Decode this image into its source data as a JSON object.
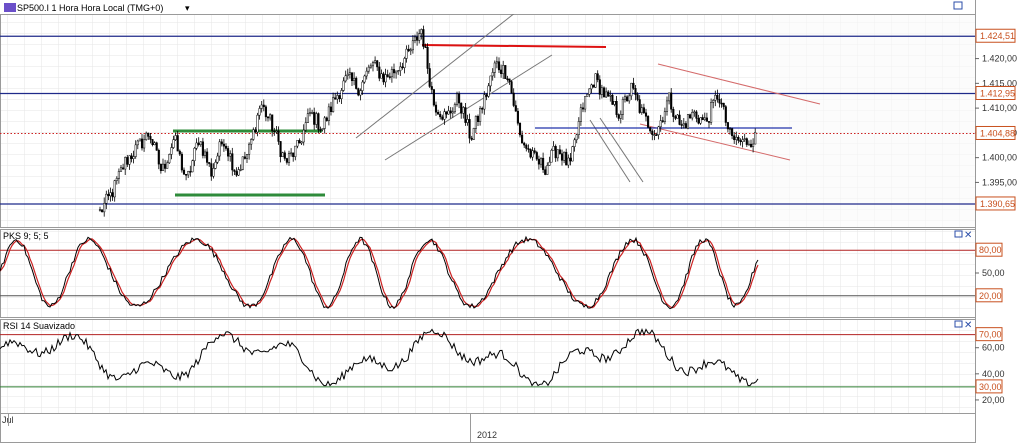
{
  "chart_data": [
    {
      "type": "candlestick",
      "title": "SP500.I 1 Hora Hora Local (TMG+0)",
      "ylim": [
        1386,
        1429
      ],
      "yticks": [
        "1.395,00",
        "1.400,00",
        "1.405,00",
        "1.410,00",
        "1.415,00",
        "1.420,00"
      ],
      "price_badges": [
        {
          "label": "1.424,51",
          "value": 1424.51,
          "color": "#c8501e"
        },
        {
          "label": "1.412,95",
          "value": 1412.95,
          "color": "#c8501e"
        },
        {
          "label": "1.404,88",
          "value": 1404.88,
          "color": "#c8501e"
        },
        {
          "label": "1.390,65",
          "value": 1390.65,
          "color": "#c8501e"
        }
      ],
      "xlabels": [
        "Jul",
        "2012"
      ],
      "keypoints": [
        1389,
        1393,
        1399,
        1402,
        1405,
        1397,
        1404,
        1395,
        1404,
        1397,
        1404,
        1397,
        1401,
        1411,
        1406,
        1399,
        1402,
        1409,
        1406,
        1412,
        1416,
        1414,
        1419,
        1416,
        1418,
        1421,
        1426,
        1411,
        1408,
        1412,
        1404,
        1411,
        1419,
        1417,
        1404,
        1400,
        1398,
        1402,
        1398,
        1410,
        1416,
        1412,
        1409,
        1414,
        1408,
        1405,
        1412,
        1406,
        1409,
        1407,
        1413,
        1404,
        1403,
        1404
      ]
    },
    {
      "type": "line",
      "title": "PKS 9; 5; 5",
      "ylim": [
        0,
        100
      ],
      "yticks": [
        "50,00"
      ],
      "levels": [
        {
          "label": "80,00",
          "value": 80,
          "color": "#b22222"
        },
        {
          "label": "20,00",
          "value": 20,
          "color": "#555555"
        }
      ],
      "series": [
        {
          "color": "#000000"
        },
        {
          "color": "#cc2222"
        }
      ]
    },
    {
      "type": "line",
      "title": "RSI 14 Suavizado",
      "ylim": [
        10,
        82
      ],
      "yticks": [
        "60,00",
        "40,00",
        "20,00"
      ],
      "levels": [
        {
          "label": "70,00",
          "value": 70,
          "color": "#b22222"
        },
        {
          "label": "30,00",
          "value": 30,
          "color": "#2e7d32"
        }
      ],
      "series": [
        {
          "color": "#000000"
        }
      ]
    }
  ]
}
